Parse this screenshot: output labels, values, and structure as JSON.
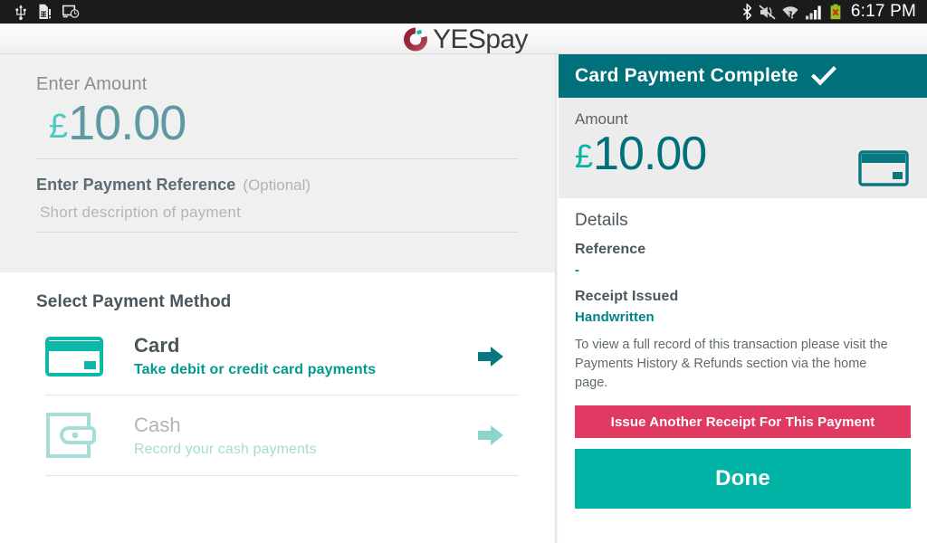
{
  "statusbar": {
    "time": "6:17 PM",
    "left_icons": [
      "usb-icon",
      "sim-card-alert-icon",
      "screen-clock-icon"
    ],
    "right_icons": [
      "bluetooth-icon",
      "sound-muted-icon",
      "wifi-icon",
      "signal-bars-icon",
      "battery-error-icon"
    ]
  },
  "brand": {
    "name_bold": "YES",
    "name_light": "pay",
    "logo_color": "#9e2b3f",
    "logo_accent": "#1bb8a8"
  },
  "left": {
    "amount_label": "Enter Amount",
    "amount_currency": "£",
    "amount_value": "10.00",
    "reference_label": "Enter Payment Reference",
    "reference_optional": "(Optional)",
    "reference_placeholder": "Short description of payment",
    "methods_title": "Select Payment Method",
    "methods": [
      {
        "id": "card",
        "title": "Card",
        "subtitle": "Take debit or credit card payments",
        "icon": "credit-card-icon",
        "enabled": true
      },
      {
        "id": "cash",
        "title": "Cash",
        "subtitle": "Record your cash payments",
        "icon": "wallet-icon",
        "enabled": false
      }
    ]
  },
  "right": {
    "header_title": "Card Payment Complete",
    "header_icon": "check-icon",
    "amount_label": "Amount",
    "amount_currency": "£",
    "amount_value": "10.00",
    "amount_icon": "credit-card-icon",
    "details_title": "Details",
    "detail_reference_key": "Reference",
    "detail_reference_value": "-",
    "detail_receipt_key": "Receipt Issued",
    "detail_receipt_value": "Handwritten",
    "note": "To view a full record of this transaction please visit the Payments History & Refunds section via the home page.",
    "secondary_button": "Issue Another Receipt For This Payment",
    "primary_button": "Done"
  },
  "colors": {
    "header_teal": "#00707a",
    "accent_teal": "#00b3a4",
    "pink": "#e03a63",
    "muted_teal": "#a2dcd6",
    "panel_gray": "#f0f0f0"
  }
}
